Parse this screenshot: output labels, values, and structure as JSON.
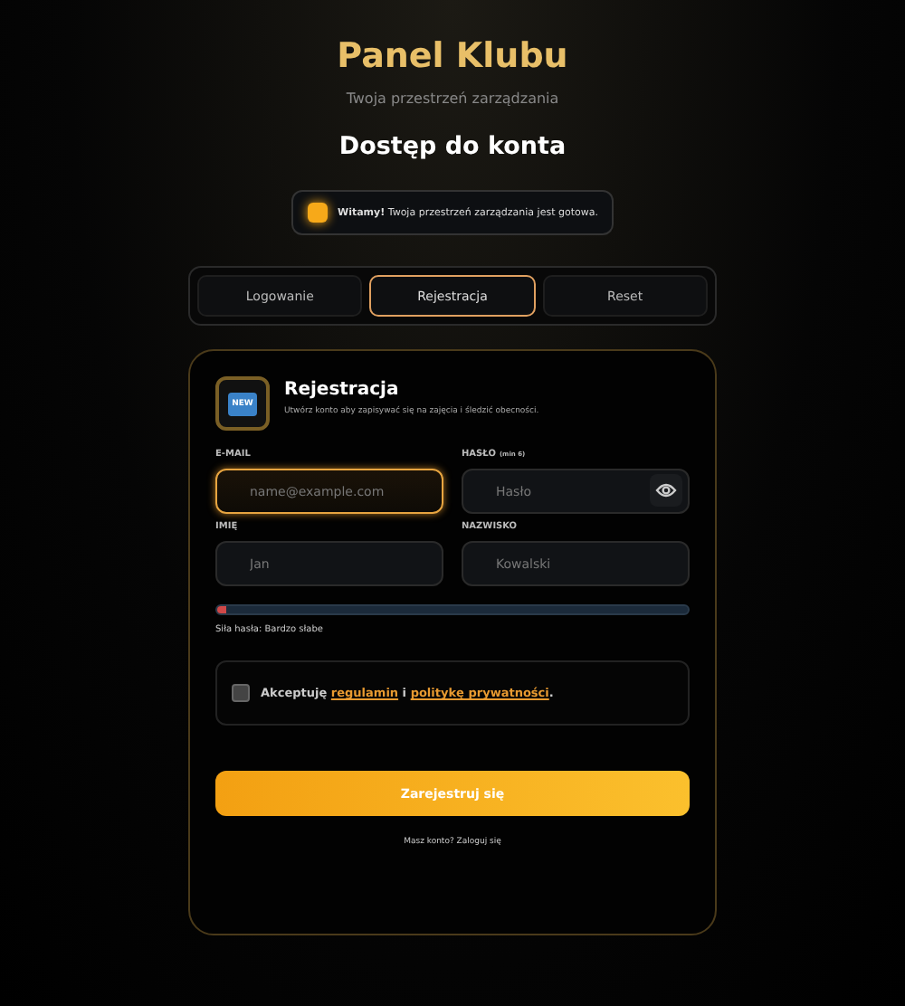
{
  "header": {
    "title": "Panel Klubu",
    "subtitle": "Twoja przestrzeń zarządzania",
    "heading": "Dostęp do konta"
  },
  "toast": {
    "text": "**Witamy!** Twoja przestrzeń zarządzania jest gotowa."
  },
  "tabs": [
    {
      "label": "Logowanie",
      "selected": false
    },
    {
      "label": "Rejestracja",
      "selected": true
    },
    {
      "label": "Reset",
      "selected": false
    }
  ],
  "card": {
    "badge": "NEW",
    "title": "Rejestracja",
    "description": "Utwórz konto aby zapisywać się na zajęcia i śledzić obecności.",
    "fields": [
      {
        "label": "E-MAIL",
        "placeholder": "name@example.com",
        "focused": true
      },
      {
        "label": "HASŁO",
        "hint": "(min 6)",
        "placeholder": "Hasło",
        "focused": false,
        "kind": "password"
      },
      {
        "label": "IMIĘ",
        "placeholder": "Jan",
        "focused": false
      },
      {
        "label": "NAZWISKO",
        "placeholder": "Kowalski",
        "focused": false
      }
    ],
    "strength": {
      "level": 0.02,
      "text": "Siła hasła: Bardzo słabe"
    },
    "terms": {
      "checked": false,
      "before": "Akceptuję ",
      "link_1": "regulamin",
      "middle": " i ",
      "link_2": "politykę prywatności",
      "after": "."
    },
    "submit": "Zarejestruj się",
    "footer": "Masz konto? Zaloguj się"
  }
}
